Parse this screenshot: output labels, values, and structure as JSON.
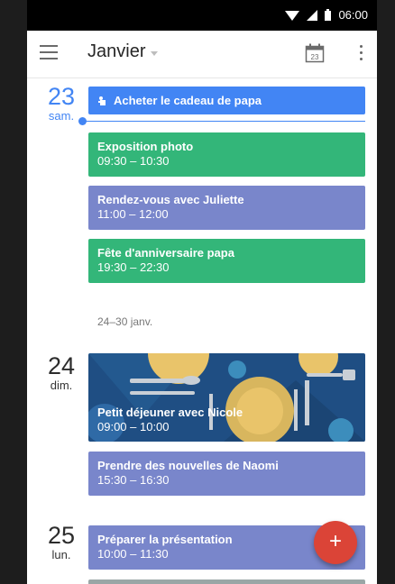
{
  "status_bar": {
    "time": "06:00"
  },
  "app_bar": {
    "title": "Janvier"
  },
  "days": [
    {
      "number": "23",
      "weekday": "sam."
    },
    {
      "number": "24",
      "weekday": "dim."
    },
    {
      "number": "25",
      "weekday": "lun."
    }
  ],
  "events": {
    "allday": "Acheter le cadeau de papa",
    "e1": {
      "title": "Exposition photo",
      "time": "09:30 – 10:30"
    },
    "e2": {
      "title": "Rendez-vous avec Juliette",
      "time": "11:00 – 12:00"
    },
    "e3": {
      "title": "Fête d'anniversaire papa",
      "time": "19:30 – 22:30"
    },
    "e4": {
      "title": "Petit déjeuner avec Nicole",
      "time": "09:00 – 10:00"
    },
    "e5": {
      "title": "Prendre des nouvelles de Naomi",
      "time": "15:30 – 16:30"
    },
    "e6": {
      "title": "Préparer la présentation",
      "time": "10:00 – 11:30"
    }
  },
  "week_separator": "24–30 janv.",
  "calendar_icon_date": "23",
  "fab_label": "+",
  "colors": {
    "blue": "#4285f4",
    "green": "#33b679",
    "lavender": "#7986cb",
    "fab": "#db4437"
  },
  "icons": [
    "menu-icon",
    "calendar-icon",
    "more-vert-icon",
    "gift-icon",
    "plus-icon",
    "wifi-icon",
    "signal-icon",
    "battery-icon"
  ]
}
